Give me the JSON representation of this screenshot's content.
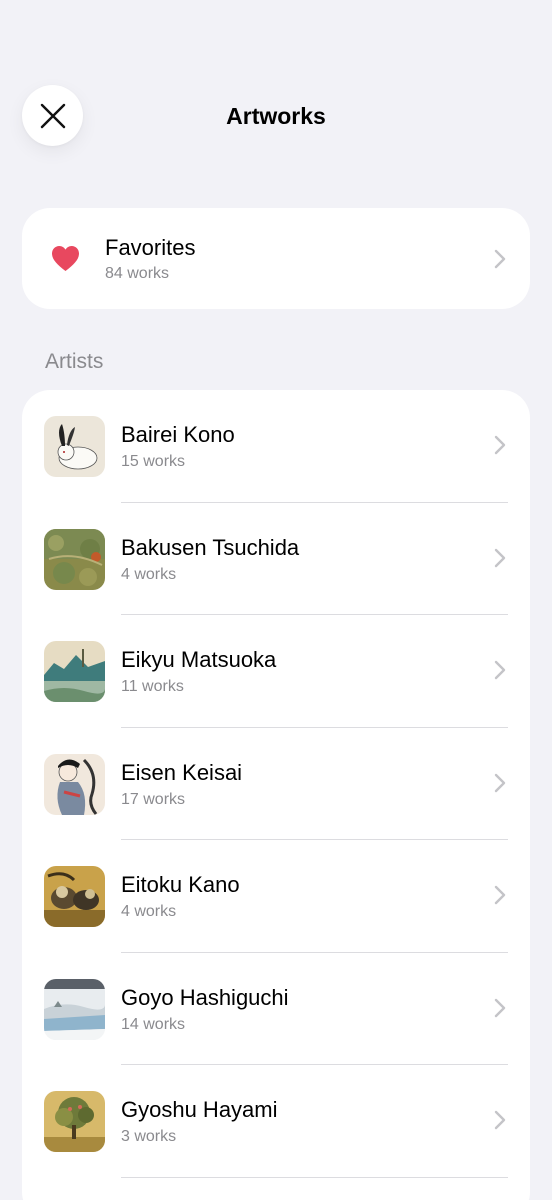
{
  "header": {
    "title": "Artworks",
    "close_icon": "close-icon"
  },
  "favorites": {
    "label": "Favorites",
    "count": "84 works",
    "icon": "heart-icon",
    "icon_color": "#e8485f"
  },
  "section": {
    "artists_label": "Artists"
  },
  "artists": [
    {
      "name": "Bairei Kono",
      "count": "15 works"
    },
    {
      "name": "Bakusen Tsuchida",
      "count": "4 works"
    },
    {
      "name": "Eikyu Matsuoka",
      "count": "11 works"
    },
    {
      "name": "Eisen Keisai",
      "count": "17 works"
    },
    {
      "name": "Eitoku Kano",
      "count": "4 works"
    },
    {
      "name": "Goyo Hashiguchi",
      "count": "14 works"
    },
    {
      "name": "Gyoshu Hayami",
      "count": "3 works"
    }
  ],
  "colors": {
    "background": "#f2f2f7",
    "card": "#ffffff",
    "secondary_text": "#8a8a8e",
    "chevron": "#c4c4c8"
  }
}
